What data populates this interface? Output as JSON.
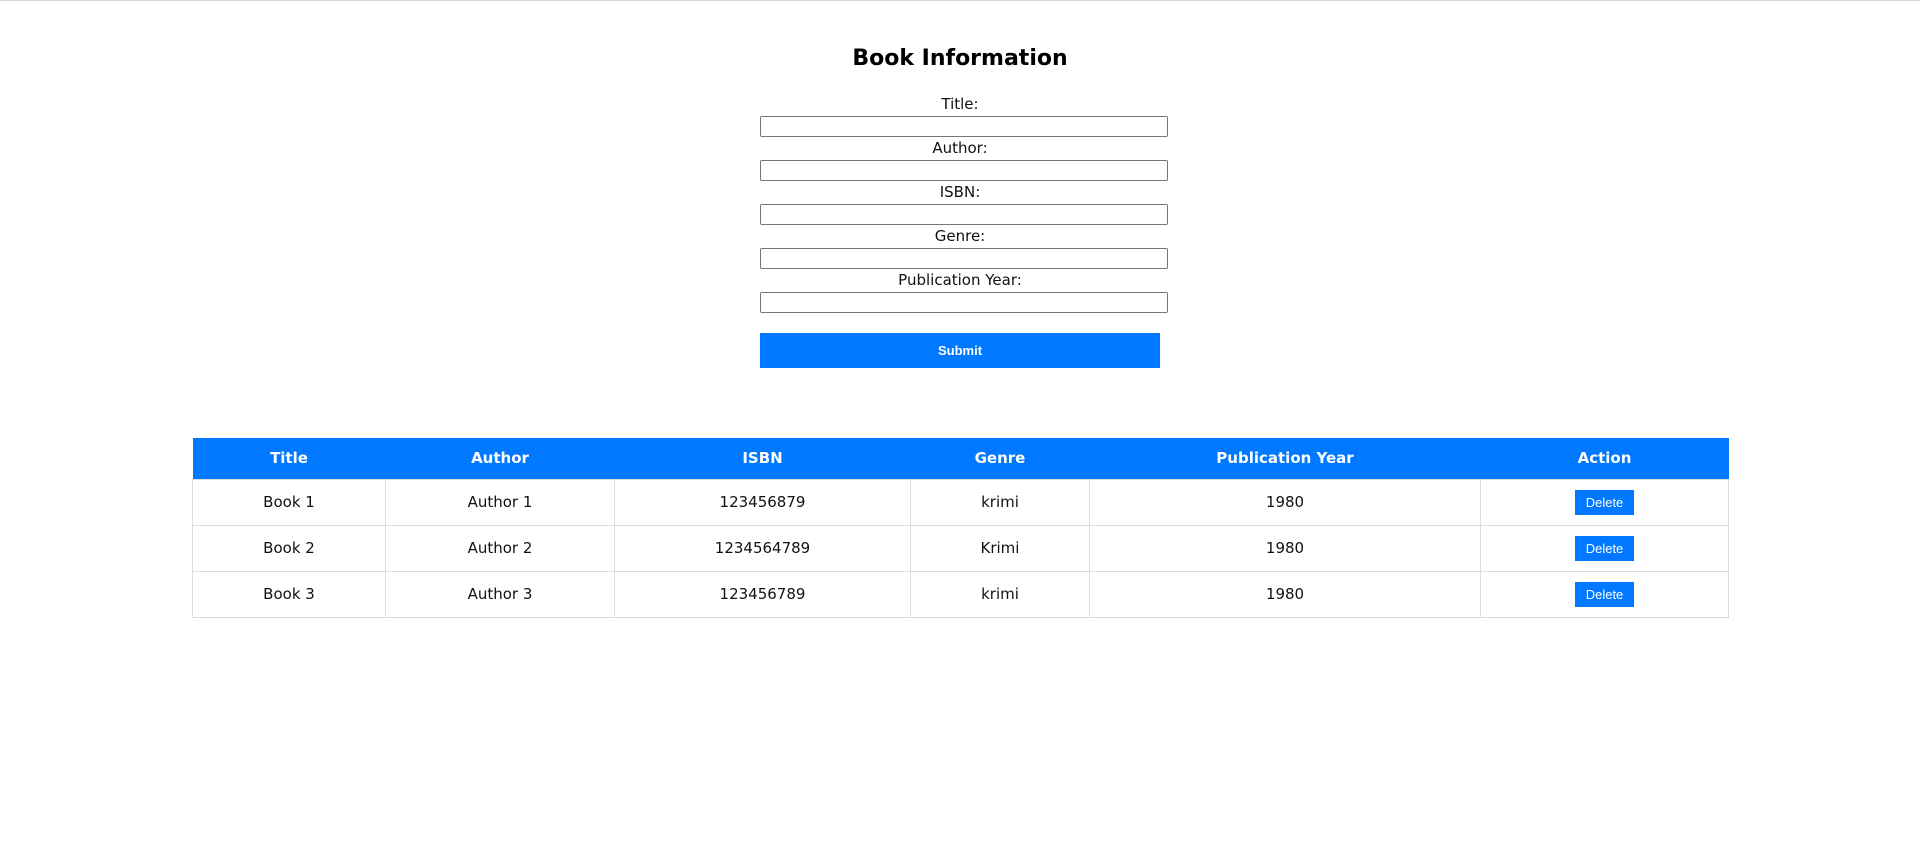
{
  "form": {
    "title": "Book Information",
    "fields": [
      {
        "label": "Title:",
        "value": ""
      },
      {
        "label": "Author:",
        "value": ""
      },
      {
        "label": "ISBN:",
        "value": ""
      },
      {
        "label": "Genre:",
        "value": ""
      },
      {
        "label": "Publication Year:",
        "value": ""
      }
    ],
    "submit_label": "Submit"
  },
  "table": {
    "headers": [
      "Title",
      "Author",
      "ISBN",
      "Genre",
      "Publication Year",
      "Action"
    ],
    "rows": [
      {
        "title": "Book 1",
        "author": "Author 1",
        "isbn": "123456879",
        "genre": "krimi",
        "year": "1980",
        "action": "Delete"
      },
      {
        "title": "Book 2",
        "author": "Author 2",
        "isbn": "1234564789",
        "genre": "Krimi",
        "year": "1980",
        "action": "Delete"
      },
      {
        "title": "Book 3",
        "author": "Author 3",
        "isbn": "123456789",
        "genre": "krimi",
        "year": "1980",
        "action": "Delete"
      }
    ]
  },
  "colors": {
    "accent": "#0078ff",
    "border": "#dcdcdc"
  }
}
